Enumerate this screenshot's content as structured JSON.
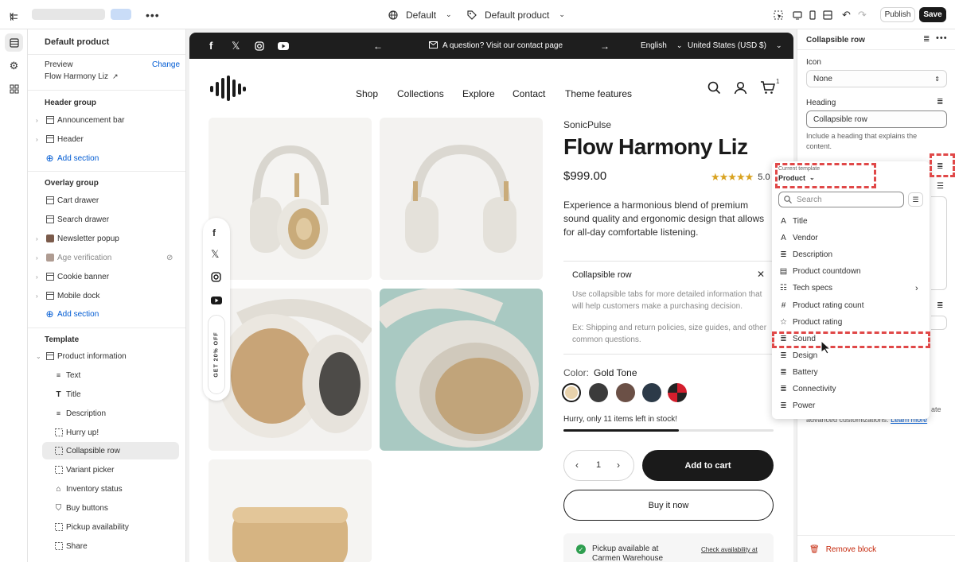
{
  "topbar": {
    "theme_label": "Default",
    "template_label": "Default product",
    "publish_label": "Publish",
    "save_label": "Save",
    "more_icon": "ellipsis-icon"
  },
  "sidebar": {
    "title": "Default product",
    "preview_label": "Preview",
    "change_label": "Change",
    "preview_product": "Flow Harmony Liz",
    "header_group_label": "Header group",
    "header_group_items": [
      "Announcement bar",
      "Header"
    ],
    "add_section_label": "Add section",
    "overlay_group_label": "Overlay group",
    "overlay_group_items": [
      "Cart drawer",
      "Search drawer",
      "Newsletter popup",
      "Age verification",
      "Cookie banner",
      "Mobile dock"
    ],
    "template_label": "Template",
    "template_section": "Product information",
    "template_blocks": [
      "Text",
      "Title",
      "Description",
      "Hurry up!",
      "Collapsible row",
      "Variant picker",
      "Inventory status",
      "Buy buttons",
      "Pickup availability",
      "Share"
    ],
    "selected_block": "Collapsible row"
  },
  "announcement": {
    "message": "A question? Visit our contact page",
    "language": "English",
    "currency": "United States (USD $)"
  },
  "store_nav": {
    "links": [
      "Shop",
      "Collections",
      "Explore",
      "Contact",
      "Theme features"
    ],
    "cart_count": "1"
  },
  "floating": {
    "promo_text": "GET 20% OFF"
  },
  "product": {
    "vendor": "SonicPulse",
    "title": "Flow Harmony Liz",
    "price": "$999.00",
    "rating": 5.0,
    "rating_text": "5.0",
    "description": "Experience a harmonious blend of premium sound quality and ergonomic design that allows for all-day comfortable listening.",
    "collapsible_heading": "Collapsible row",
    "collapsible_body1": "Use collapsible tabs for more detailed information that will help customers make a purchasing decision.",
    "collapsible_body2": "Ex: Shipping and return policies, size guides, and other common questions.",
    "color_label": "Color:",
    "color_value": "Gold Tone",
    "swatches": [
      "#e8d2ac",
      "#3b3b3b",
      "#6b5046",
      "#2c3a48",
      "#d41e2d"
    ],
    "stock_text": "Hurry, only 11 items left in stock!",
    "stock_fraction": 0.55,
    "quantity": "1",
    "add_to_cart": "Add to cart",
    "buy_now": "Buy it now",
    "pickup_text": "Pickup available at",
    "pickup_location": "Carmen Warehouse",
    "check_availability": "Check availability at"
  },
  "right_panel": {
    "title": "Collapsible row",
    "icon_label": "Icon",
    "icon_value": "None",
    "heading_label": "Heading",
    "heading_value": "Collapsible row",
    "heading_help": "Include a heading that explains the content.",
    "partial_help": "ate",
    "partial_help2": "advanced customizations.",
    "learn_more": "Learn more",
    "remove_block": "Remove block"
  },
  "dynamic_source_popup": {
    "current_template_label": "Current template",
    "template_value": "Product",
    "search_placeholder": "Search",
    "items": [
      {
        "label": "Title",
        "icon": "text-icon"
      },
      {
        "label": "Vendor",
        "icon": "text-icon"
      },
      {
        "label": "Description",
        "icon": "paragraph-icon"
      },
      {
        "label": "Product countdown",
        "icon": "metaobject-icon"
      },
      {
        "label": "Tech specs",
        "icon": "list-icon",
        "has_submenu": true
      },
      {
        "label": "Product rating count",
        "icon": "hash-icon"
      },
      {
        "label": "Product rating",
        "icon": "star-icon"
      },
      {
        "label": "Sound",
        "icon": "paragraph-icon"
      },
      {
        "label": "Design",
        "icon": "paragraph-icon"
      },
      {
        "label": "Battery",
        "icon": "paragraph-icon"
      },
      {
        "label": "Connectivity",
        "icon": "paragraph-icon"
      },
      {
        "label": "Power",
        "icon": "paragraph-icon"
      }
    ]
  },
  "colors": {
    "accent": "#005bd3",
    "highlight": "#e04848",
    "dark": "#1a1a1a"
  }
}
